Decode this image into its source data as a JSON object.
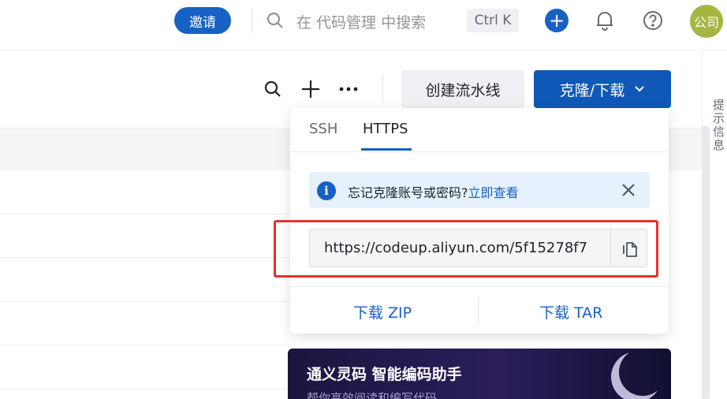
{
  "topbar": {
    "invite_label": "邀请",
    "search_placeholder": "在 代码管理 中搜索",
    "shortcut": "Ctrl K",
    "add_symbol": "+",
    "avatar_text": "公司"
  },
  "toolbar": {
    "pipeline_label": "创建流水线",
    "clone_label": "克隆/下载"
  },
  "right_rail": {
    "text": "提示信息"
  },
  "clone_popup": {
    "tabs": [
      {
        "label": "SSH",
        "active": false
      },
      {
        "label": "HTTPS",
        "active": true
      }
    ],
    "notice_text": "忘记克隆账号或密码?",
    "notice_link": "立即查看",
    "url": "https://codeup.aliyun.com/5f15278f7",
    "download_zip": "下载 ZIP",
    "download_tar": "下载 TAR"
  },
  "banner": {
    "title": "通义灵码 智能编码助手",
    "subtitle": "帮你高效阅读和编写代码"
  },
  "colors": {
    "primary": "#1761c4",
    "highlight": "#e5312e",
    "notice_bg": "#e6f1fd"
  }
}
